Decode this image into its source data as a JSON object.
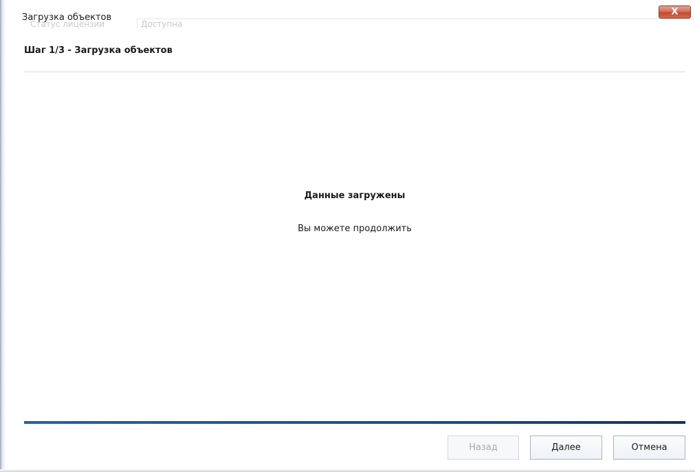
{
  "window": {
    "title": "Загрузка объектов",
    "close_label": "X",
    "background_tabs": [
      "Статус лицензии",
      "Доступна"
    ]
  },
  "wizard": {
    "step_title": "Шаг 1/3 - Загрузка объектов",
    "status_title": "Данные загружены",
    "status_message": "Вы можете продолжить",
    "progress": 1.0
  },
  "buttons": {
    "back": {
      "label": "Назад",
      "enabled": false
    },
    "next": {
      "label": "Далее",
      "enabled": true
    },
    "cancel": {
      "label": "Отмена",
      "enabled": true
    }
  },
  "colors": {
    "progress_fill": "#0f4c8c",
    "close_button": "#c24a31"
  },
  "icons": {
    "close": "close-icon"
  }
}
